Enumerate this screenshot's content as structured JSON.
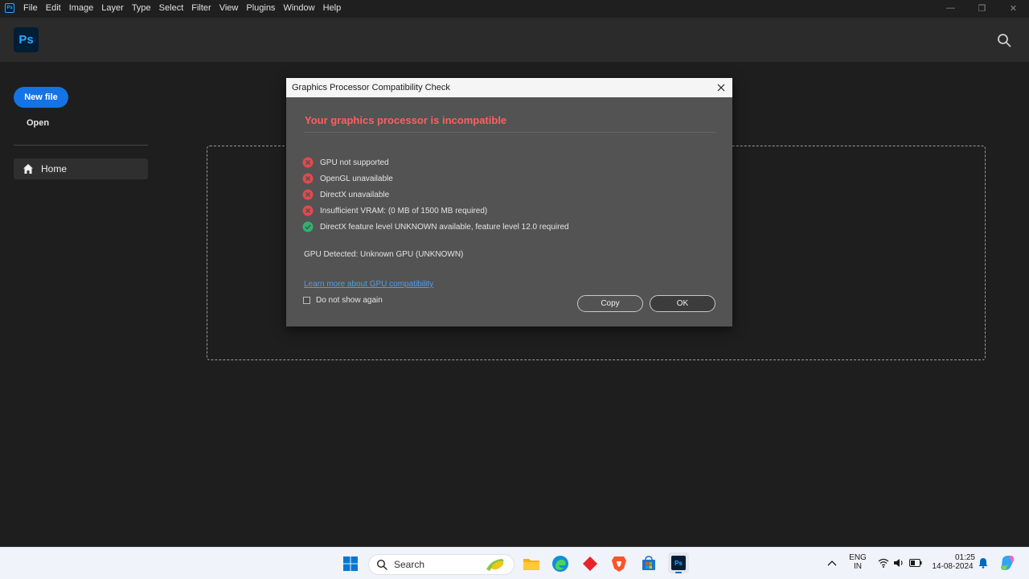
{
  "menubar": {
    "app_badge": "Ps",
    "items": [
      "File",
      "Edit",
      "Image",
      "Layer",
      "Type",
      "Select",
      "Filter",
      "View",
      "Plugins",
      "Window",
      "Help"
    ],
    "controls": [
      "—",
      "❐",
      "✕"
    ]
  },
  "header": {
    "logo": "Ps",
    "search_icon": "search-icon"
  },
  "sidebar": {
    "new_file_label": "New file",
    "open_label": "Open",
    "home_label": "Home"
  },
  "dialog": {
    "title": "Graphics Processor Compatibility Check",
    "heading": "Your graphics processor is incompatible",
    "checks": [
      {
        "status": "error",
        "text": "GPU not supported"
      },
      {
        "status": "error",
        "text": "OpenGL unavailable"
      },
      {
        "status": "error",
        "text": "DirectX unavailable"
      },
      {
        "status": "error",
        "text": "Insufficient VRAM: (0 MB of 1500 MB required)"
      },
      {
        "status": "ok",
        "text": "DirectX feature level UNKNOWN available, feature level 12.0 required"
      }
    ],
    "gpu_detected": "GPU Detected: Unknown GPU (UNKNOWN)",
    "learn_more": "Learn more about GPU compatibility",
    "do_not_show": "Do not show again",
    "copy_label": "Copy",
    "ok_label": "OK",
    "colors": {
      "error": "#e5484d",
      "ok": "#2fb36b",
      "heading": "#ff5f5f"
    }
  },
  "taskbar": {
    "search_placeholder": "Search",
    "lang_line1": "ENG",
    "lang_line2": "IN",
    "time": "01:25",
    "date": "14-08-2024",
    "taskbar_ps": "Ps"
  }
}
